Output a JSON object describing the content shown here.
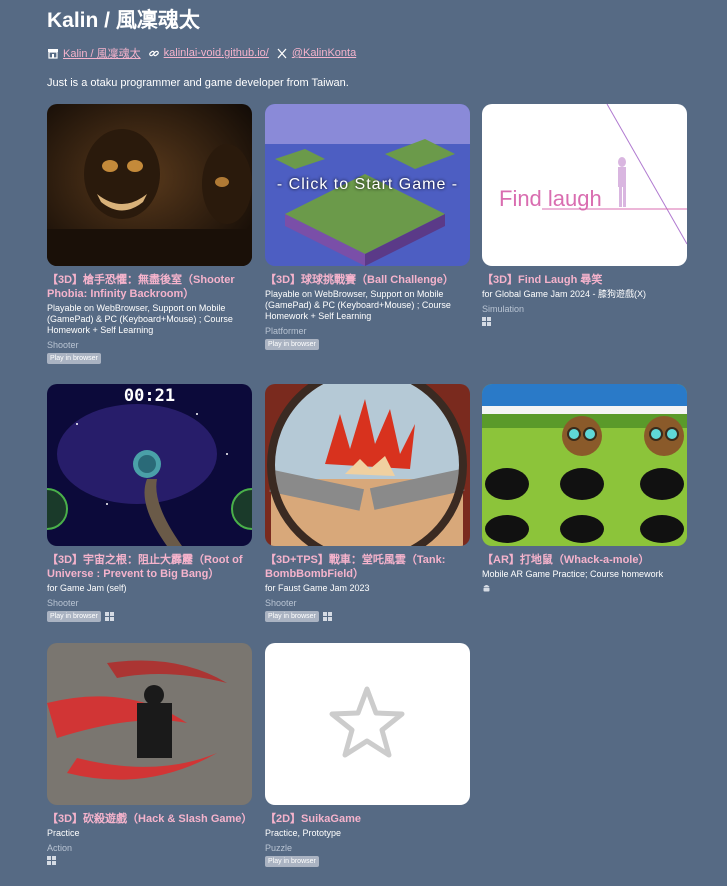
{
  "header": {
    "title": "Kalin / 風凜魂太",
    "links": [
      {
        "icon": "store-icon",
        "label": "Kalin / 風凜魂太"
      },
      {
        "icon": "link-icon",
        "label": "kalinlai-void.github.io/"
      },
      {
        "icon": "x-icon",
        "label": "@KalinKonta"
      }
    ],
    "tagline": "Just is a otaku programmer and game developer from Taiwan."
  },
  "games": [
    {
      "title": "【3D】槍手恐懼：無盡後室（Shooter Phobia: Infinity Backroom）",
      "desc": "Playable on WebBrowser, Support on Mobile (GamePad) & PC (Keyboard+Mouse) ; Course Homework + Self Learning",
      "genre": "Shooter",
      "badge": "Play in browser",
      "platforms": []
    },
    {
      "title": "【3D】球球挑戰賽（Ball Challenge）",
      "desc": "Playable on WebBrowser, Support on Mobile (GamePad) & PC (Keyboard+Mouse) ; Course Homework + Self Learning",
      "genre": "Platformer",
      "badge": "Play in browser",
      "platforms": [],
      "overlay": "- Click to Start Game -"
    },
    {
      "title": "【3D】Find Laugh 尋笑",
      "desc": "for Global Game Jam 2024 - 膝狗遊戲(X)",
      "genre": "Simulation",
      "badge": "",
      "platforms": [
        "windows-icon"
      ],
      "thumb_text": "Find laugh"
    },
    {
      "title": "【3D】宇宙之根：阻止大霹靂（Root of Universe : Prevent to Big Bang）",
      "desc": "for Game Jam (self)",
      "genre": "Shooter",
      "badge": "Play in browser",
      "platforms": [
        "windows-icon"
      ],
      "timer": "00:21"
    },
    {
      "title": "【3D+TPS】戰車：堂吒風雲（Tank: BombBombField）",
      "desc": "for Faust Game Jam 2023",
      "genre": "Shooter",
      "badge": "Play in browser",
      "platforms": [
        "windows-icon"
      ]
    },
    {
      "title": "【AR】打地鼠（Whack-a-mole）",
      "desc": "Mobile AR Game Practice; Course homework",
      "genre": "",
      "badge": "",
      "platforms": [
        "android-icon"
      ]
    },
    {
      "title": "【3D】砍殺遊戲（Hack & Slash Game）",
      "desc": "Practice",
      "genre": "Action",
      "badge": "",
      "platforms": [
        "windows-icon"
      ]
    },
    {
      "title": "【2D】SuikaGame",
      "desc": "Practice, Prototype",
      "genre": "Puzzle",
      "badge": "Play in browser",
      "platforms": []
    }
  ],
  "colors": {
    "background": "#566a84",
    "link": "#f5b3cc",
    "card_title": "#f5b3cc",
    "genre": "#b9c4d3",
    "badge_bg": "#aab3c2"
  }
}
